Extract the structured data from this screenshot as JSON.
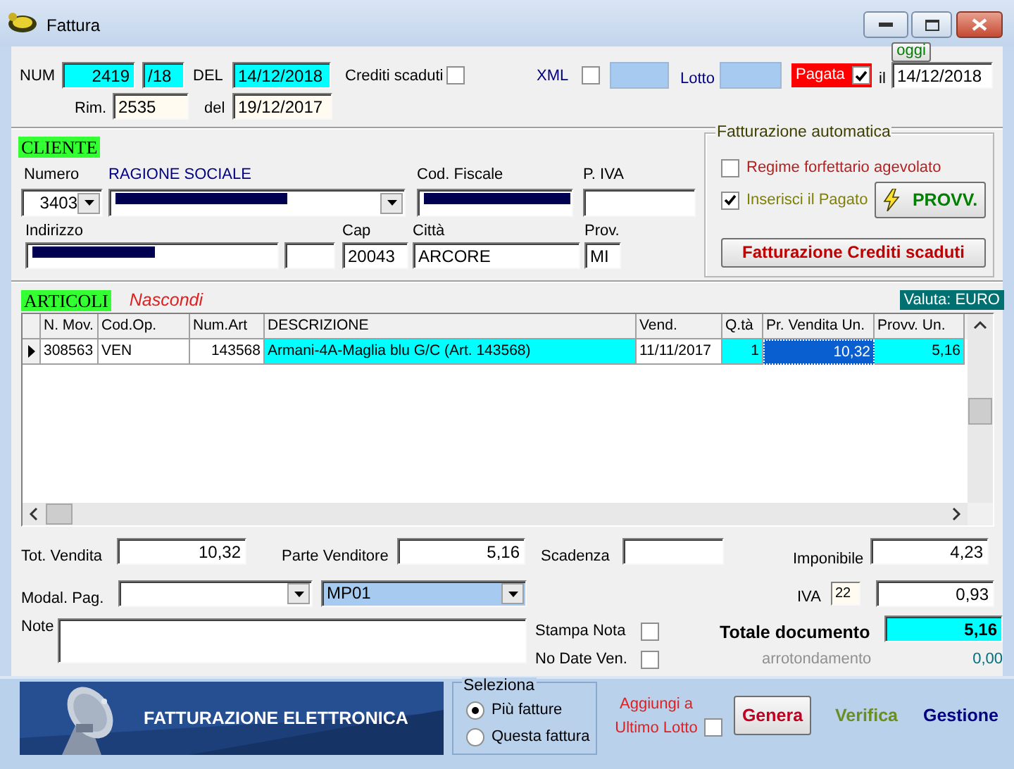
{
  "window": {
    "title": "Fattura"
  },
  "header": {
    "num": {
      "label": "NUM",
      "value": "2419",
      "suffix": "/18"
    },
    "del": {
      "label": "DEL",
      "value": "14/12/2018"
    },
    "crediti_scaduti": {
      "label": "Crediti scaduti",
      "checked": false
    },
    "xml": {
      "label": "XML",
      "checked": false
    },
    "lotto": {
      "label": "Lotto"
    },
    "pagata": {
      "label": "Pagata",
      "checked": true
    },
    "pagata_date": {
      "label": "il",
      "value": "14/12/2018"
    },
    "today_button": "oggi",
    "rim": {
      "label": "Rim.",
      "value": "2535"
    },
    "rim_del": {
      "label": "del",
      "value": "19/12/2017"
    }
  },
  "cliente": {
    "title": "CLIENTE",
    "numero": {
      "label": "Numero",
      "value": "3403"
    },
    "ragione_sociale": {
      "label": "RAGIONE SOCIALE",
      "redacted": true
    },
    "codice_fiscale": {
      "label": "Cod. Fiscale",
      "redacted": true
    },
    "partita_iva": {
      "label": "P. IVA"
    },
    "indirizzo": {
      "label": "Indirizzo",
      "redacted": true
    },
    "cap": {
      "label": "Cap",
      "value": "20043"
    },
    "citta": {
      "label": "Città",
      "value": "ARCORE"
    },
    "provincia": {
      "label": "Prov.",
      "value": "MI"
    }
  },
  "fatturazione_automatica": {
    "title": "Fatturazione automatica",
    "options": [
      {
        "label": "Regime forfettario agevolato",
        "checked": false
      },
      {
        "label": "Inserisci il Pagato",
        "checked": true
      }
    ],
    "provv_button": "PROVV.",
    "crediti_button": "Fatturazione Crediti scaduti"
  },
  "articoli": {
    "title": "ARTICOLI",
    "hide_link": "Nascondi",
    "currency": "Valuta: EURO",
    "columns": [
      "N. Mov.",
      "Cod.Op.",
      "Num.Art",
      "DESCRIZIONE",
      "Vend.",
      "Q.tà",
      "Pr. Vendita Un.",
      "Provv. Un."
    ],
    "rows": [
      {
        "selected": true,
        "cells": [
          {
            "text": "308563",
            "editable": false,
            "focused": false
          },
          {
            "text": "VEN",
            "editable": false,
            "focused": false
          },
          {
            "text": "143568",
            "editable": false,
            "focused": false
          },
          {
            "text": "Armani-4A-Maglia blu G/C (Art. 143568)",
            "editable": true,
            "focused": false
          },
          {
            "text": "11/11/2017",
            "editable": false,
            "focused": false
          },
          {
            "text": "1",
            "editable": true,
            "focused": false
          },
          {
            "text": "10,32",
            "editable": true,
            "focused": true
          },
          {
            "text": "5,16",
            "editable": true,
            "focused": false
          }
        ]
      }
    ]
  },
  "totals": {
    "tot_vendita": {
      "label": "Tot. Vendita",
      "value": "10,32"
    },
    "parte_venditore": {
      "label": "Parte Venditore",
      "value": "5,16"
    },
    "scadenza": {
      "label": "Scadenza"
    },
    "imponibile": {
      "label": "Imponibile",
      "value": "4,23"
    },
    "modal_pag": {
      "label": "Modal. Pag.",
      "code": "MP01"
    },
    "iva": {
      "label": "IVA",
      "rate": "22",
      "value": "0,93"
    },
    "note": {
      "label": "Note"
    },
    "stampa_nota": {
      "label": "Stampa Nota",
      "checked": false
    },
    "no_date_ven": {
      "label": "No Date Ven.",
      "checked": false
    },
    "totale": {
      "label": "Totale documento",
      "value": "5,16"
    },
    "arrotondamento": {
      "label": "arrotondamento",
      "value": "0,00"
    }
  },
  "footer": {
    "banner_text": "FATTURAZIONE ELETTRONICA",
    "seleziona": {
      "title": "Seleziona",
      "options": [
        {
          "label": "Più fatture",
          "selected": true
        },
        {
          "label": "Questa fattura",
          "selected": false
        }
      ]
    },
    "aggiungi": {
      "label": "Aggiungi a Ultimo Lotto",
      "checked": false
    },
    "genera_button": "Genera",
    "verifica_link": "Verifica",
    "gestione_link": "Gestione"
  }
}
